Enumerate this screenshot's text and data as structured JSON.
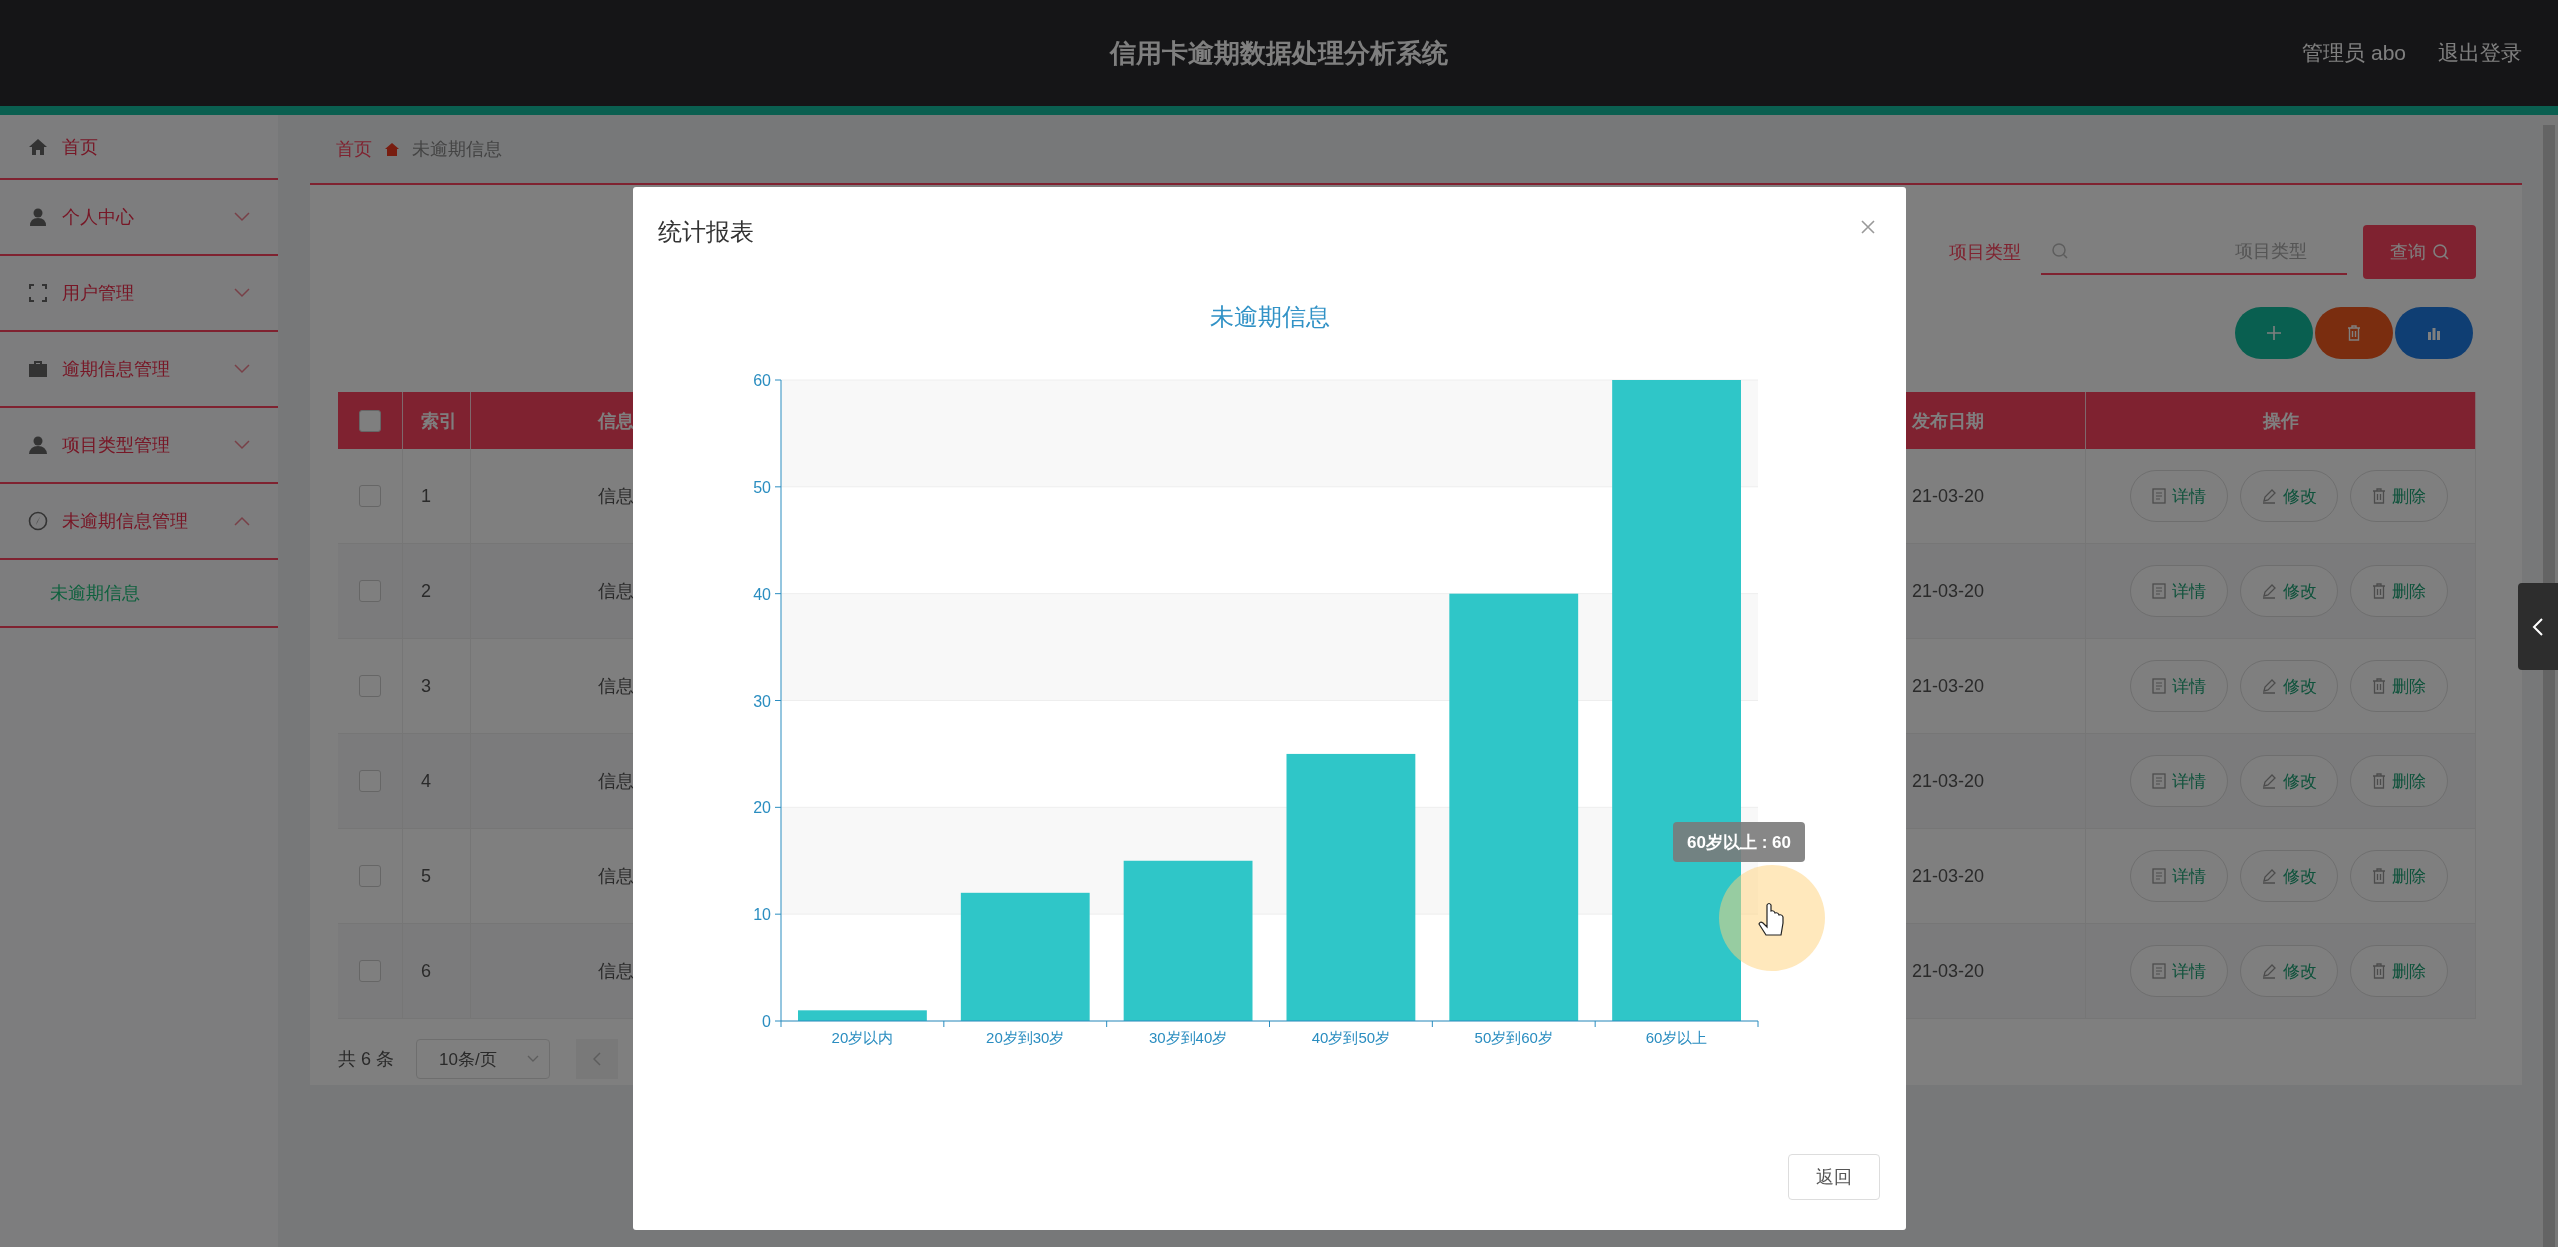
{
  "header": {
    "title": "信用卡逾期数据处理分析系统",
    "user": "管理员 abo",
    "logout": "退出登录"
  },
  "sidebar": {
    "items": [
      {
        "label": "首页",
        "kind": "link"
      },
      {
        "label": "个人中心",
        "kind": "menu",
        "expanded": false
      },
      {
        "label": "用户管理",
        "kind": "menu",
        "expanded": false
      },
      {
        "label": "逾期信息管理",
        "kind": "menu",
        "expanded": false
      },
      {
        "label": "项目类型管理",
        "kind": "menu",
        "expanded": false
      },
      {
        "label": "未逾期信息管理",
        "kind": "menu",
        "expanded": true,
        "children": [
          {
            "label": "未逾期信息",
            "selected": true
          }
        ]
      }
    ]
  },
  "breadcrumb": [
    "首页",
    "未逾期信息"
  ],
  "search": {
    "label": "项目类型",
    "placeholder": "项目类型",
    "button": "查询"
  },
  "table": {
    "select_all_checked": false,
    "columns": [
      "索引",
      "信息",
      "发布日期",
      "操作"
    ],
    "rows": [
      {
        "index": "1",
        "info": "信息",
        "date": "21-03-20",
        "checked": false,
        "actions": [
          "详情",
          "修改",
          "删除"
        ]
      },
      {
        "index": "2",
        "info": "信息",
        "date": "21-03-20",
        "checked": false,
        "actions": [
          "详情",
          "修改",
          "删除"
        ]
      },
      {
        "index": "3",
        "info": "信息",
        "date": "21-03-20",
        "checked": false,
        "actions": [
          "详情",
          "修改",
          "删除"
        ]
      },
      {
        "index": "4",
        "info": "信息",
        "date": "21-03-20",
        "checked": false,
        "actions": [
          "详情",
          "修改",
          "删除"
        ]
      },
      {
        "index": "5",
        "info": "信息",
        "date": "21-03-20",
        "checked": false,
        "actions": [
          "详情",
          "修改",
          "删除"
        ]
      },
      {
        "index": "6",
        "info": "信息",
        "date": "21-03-20",
        "checked": false,
        "actions": [
          "详情",
          "修改",
          "删除"
        ]
      }
    ]
  },
  "pagination": {
    "total": "共 6 条",
    "page_size": "10条/页"
  },
  "dialog": {
    "title": "统计报表",
    "chart_data": {
      "type": "bar",
      "title": "未逾期信息",
      "categories": [
        "20岁以内",
        "20岁到30岁",
        "30岁到40岁",
        "40岁到50岁",
        "50岁到60岁",
        "60岁以上"
      ],
      "values": [
        1,
        12,
        15,
        25,
        40,
        60
      ],
      "grid": true,
      "ylim": [
        0,
        60
      ],
      "yticks": [
        0,
        10,
        20,
        30,
        40,
        50,
        60
      ]
    },
    "tooltip": "60岁以上 : 60",
    "button": "返回"
  }
}
